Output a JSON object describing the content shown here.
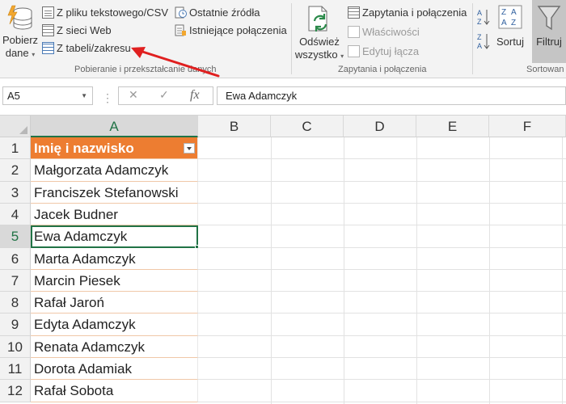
{
  "ribbon": {
    "get_data": {
      "line1": "Pobierz",
      "line2": "dane"
    },
    "source_items": [
      {
        "name": "from-text-csv",
        "label": "Z pliku tekstowego/CSV",
        "icon": "text-file-icon"
      },
      {
        "name": "from-web",
        "label": "Z sieci Web",
        "icon": "web-icon"
      },
      {
        "name": "from-table-range",
        "label": "Z tabeli/zakresu",
        "icon": "table-icon"
      },
      {
        "name": "recent-sources",
        "label": "Ostatnie źródła",
        "icon": "clock-icon"
      },
      {
        "name": "existing-connections",
        "label": "Istniejące połączenia",
        "icon": "connections-icon"
      }
    ],
    "group1_label": "Pobieranie i przekształcanie danych",
    "refresh": {
      "line1": "Odśwież",
      "line2": "wszystko"
    },
    "queries_items": [
      {
        "name": "queries-connections",
        "label": "Zapytania i połączenia",
        "disabled": false
      },
      {
        "name": "properties",
        "label": "Właściwości",
        "disabled": true
      },
      {
        "name": "edit-links",
        "label": "Edytuj łącza",
        "disabled": true
      }
    ],
    "group2_label": "Zapytania i połączenia",
    "sort": {
      "label": "Sortuj"
    },
    "filter": {
      "label": "Filtruj"
    },
    "group3_label": "Sortowan"
  },
  "formula_bar": {
    "name_box": "A5",
    "cancel_icon": "✕",
    "enter_icon": "✓",
    "fx_label": "fx",
    "formula": "Ewa Adamczyk"
  },
  "grid": {
    "columns": [
      "A",
      "B",
      "C",
      "D",
      "E",
      "F"
    ],
    "rows": [
      {
        "num": "1",
        "value": "Imię i nazwisko"
      },
      {
        "num": "2",
        "value": "Małgorzata Adamczyk"
      },
      {
        "num": "3",
        "value": "Franciszek Stefanowski"
      },
      {
        "num": "4",
        "value": "Jacek Budner"
      },
      {
        "num": "5",
        "value": "Ewa Adamczyk"
      },
      {
        "num": "6",
        "value": "Marta Adamczyk"
      },
      {
        "num": "7",
        "value": "Marcin Piesek"
      },
      {
        "num": "8",
        "value": "Rafał Jaroń"
      },
      {
        "num": "9",
        "value": "Edyta Adamczyk"
      },
      {
        "num": "10",
        "value": "Renata Adamczyk"
      },
      {
        "num": "11",
        "value": "Dorota Adamiak"
      },
      {
        "num": "12",
        "value": "Rafał Sobota"
      }
    ],
    "active_cell": "A5",
    "header_fill": "#ed7d31",
    "selection_color": "#217346"
  },
  "annotation": {
    "arrow_color": "#e02020"
  }
}
